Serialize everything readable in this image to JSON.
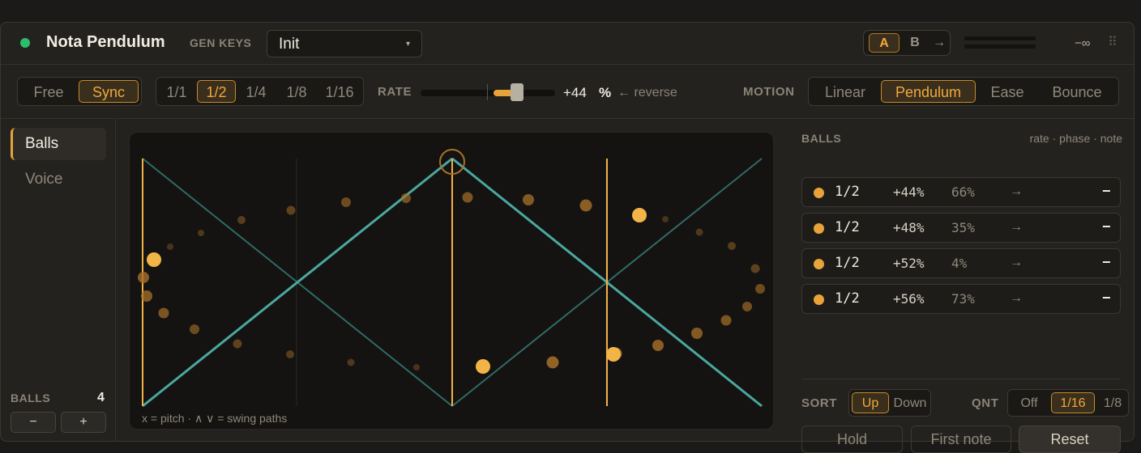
{
  "header": {
    "title": "Nota Pendulum",
    "gen_keys_label": "GEN KEYS",
    "preset": "Init",
    "preset_chevron": "▾",
    "ab": {
      "a": "A",
      "b": "B",
      "copy": "→"
    },
    "meter_value": "−∞",
    "grip": "⠿",
    "status_color": "#2dbd6a"
  },
  "toolbar": {
    "mode": {
      "options": [
        "Free",
        "Sync"
      ],
      "selected": "Sync"
    },
    "divisions": {
      "options": [
        "1/1",
        "1/2",
        "1/4",
        "1/8",
        "1/16"
      ],
      "selected": "1/2"
    },
    "rate_label": "RATE",
    "rate_value": "+44",
    "rate_unit": "%",
    "rate_percent": 44,
    "reverse": "← reverse",
    "motion_label": "MOTION",
    "motion": {
      "options": [
        "Linear",
        "Pendulum",
        "Ease",
        "Bounce"
      ],
      "selected": "Pendulum"
    }
  },
  "sidebar": {
    "items": [
      "Balls",
      "Voice"
    ],
    "selected": "Balls",
    "balls_label": "BALLS",
    "balls_count": "4",
    "minus": "−",
    "plus": "+"
  },
  "canvas": {
    "caption": "x = pitch · ∧  ∨  = swing paths"
  },
  "balls": {
    "label": "BALLS",
    "hint": "rate · phase · note",
    "rows": [
      {
        "div": "1/2",
        "rate": "+44%",
        "phase": "66%",
        "note": "→",
        "remove": "−"
      },
      {
        "div": "1/2",
        "rate": "+48%",
        "phase": "35%",
        "note": "→",
        "remove": "−"
      },
      {
        "div": "1/2",
        "rate": "+52%",
        "phase": "4%",
        "note": "→",
        "remove": "−"
      },
      {
        "div": "1/2",
        "rate": "+56%",
        "phase": "73%",
        "note": "→",
        "remove": "−"
      }
    ],
    "sort_label": "SORT",
    "sort": {
      "options": [
        "Up",
        "Down"
      ],
      "selected": "Up"
    },
    "qnt_label": "QNT",
    "qnt": {
      "options": [
        "Off",
        "1/16",
        "1/8"
      ],
      "selected": "1/16"
    },
    "actions": [
      "Hold",
      "First note",
      "Reset"
    ]
  },
  "colors": {
    "accent": "#e8a33a",
    "teal": "#4aa79f",
    "background": "#24221f"
  }
}
